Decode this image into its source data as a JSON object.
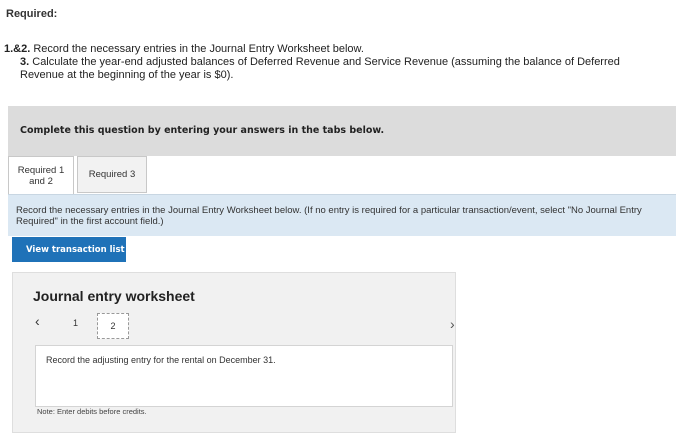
{
  "heading": "Required:",
  "instructions": {
    "item1_num": "1.&2.",
    "item1_text": " Record the necessary entries in the Journal Entry Worksheet below.",
    "item2_num": "3.",
    "item2_text": " Calculate the year-end adjusted balances of Deferred Revenue and Service Revenue (assuming the balance of Deferred Revenue at the beginning of the year is $0)."
  },
  "complete_prompt": "Complete this question by entering your answers in the tabs below.",
  "tabs": [
    {
      "label_line1": "Required 1",
      "label_line2": "and 2"
    },
    {
      "label": "Required 3"
    }
  ],
  "record_panel_text": "Record the necessary entries in the Journal Entry Worksheet below. (If no entry is required for a particular transaction/event, select \"No Journal Entry Required\" in the first account field.)",
  "view_button": "View transaction list",
  "worksheet": {
    "title": "Journal entry worksheet",
    "prev_icon": "chevron-left-icon",
    "next_icon": "chevron-right-icon",
    "pages": [
      "1",
      "2"
    ],
    "current_page": "2",
    "entry_text": "Record the adjusting entry for the rental on December 31.",
    "note": "Note: Enter debits before credits."
  }
}
